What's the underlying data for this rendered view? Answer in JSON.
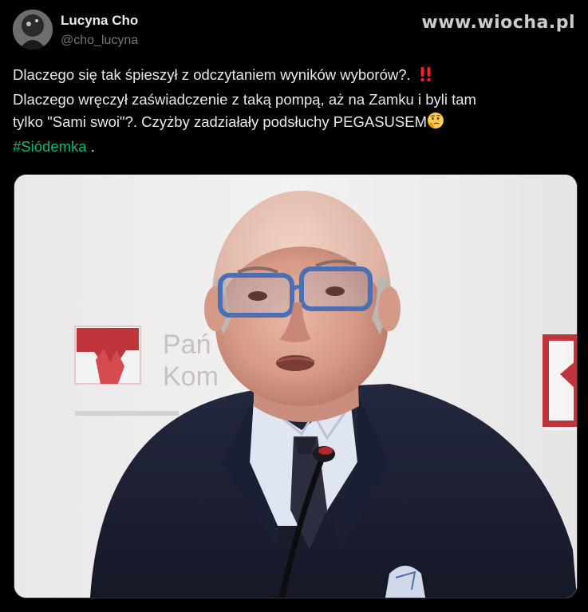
{
  "author": {
    "display_name": "Lucyna Cho",
    "handle": "@cho_lucyna"
  },
  "watermark": "www.wiocha.pl",
  "tweet": {
    "line1": "Dlaczego się tak śpieszył z odczytaniem wyników wyborów?.",
    "line2": "Dlaczego wręczył zaświadczenie z taką pompą, aż na Zamku i byli tam",
    "line3": "tylko \"Sami swoi\"?. Czyżby zadziałały podsłuchy PEGASUSEM",
    "hashtag": "#Siódemka",
    "trailing": ".",
    "emoji_line1": "double-exclamation-emoji",
    "emoji_line3": "thinking-face-emoji"
  },
  "media": {
    "background_logo_text_1": "Pań",
    "background_logo_text_2": "Kom"
  },
  "colors": {
    "background": "#000000",
    "text": "#e7e9ea",
    "muted": "#71767b",
    "hashtag": "#00ba7c",
    "exclamation": "#f4212e"
  }
}
